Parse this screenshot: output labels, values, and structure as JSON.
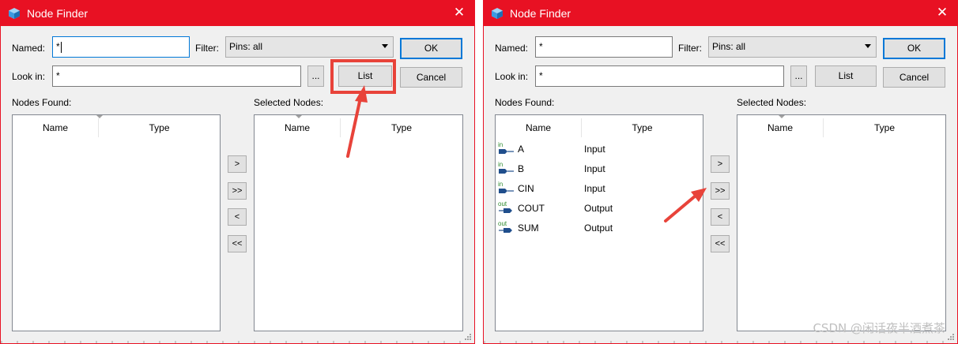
{
  "dialogs": [
    {
      "title": "Node Finder",
      "close_glyph": "✕",
      "named_label": "Named:",
      "named_value": "*",
      "filter_label": "Filter:",
      "filter_value": "Pins: all",
      "ok_label": "OK",
      "lookin_label": "Look in:",
      "lookin_value": "*",
      "browse_label": "...",
      "list_label": "List",
      "cancel_label": "Cancel",
      "nodes_found_label": "Nodes Found:",
      "selected_nodes_label": "Selected Nodes:",
      "col_name": "Name",
      "col_type": "Type",
      "move_one_label": ">",
      "move_all_label": ">>",
      "remove_one_label": "<",
      "remove_all_label": "<<",
      "nodes_found": []
    },
    {
      "title": "Node Finder",
      "close_glyph": "✕",
      "named_label": "Named:",
      "named_value": "*",
      "filter_label": "Filter:",
      "filter_value": "Pins: all",
      "ok_label": "OK",
      "lookin_label": "Look in:",
      "lookin_value": "*",
      "browse_label": "...",
      "list_label": "List",
      "cancel_label": "Cancel",
      "nodes_found_label": "Nodes Found:",
      "selected_nodes_label": "Selected Nodes:",
      "col_name": "Name",
      "col_type": "Type",
      "move_one_label": ">",
      "move_all_label": ">>",
      "remove_one_label": "<",
      "remove_all_label": "<<",
      "nodes_found": [
        {
          "name": "A",
          "type": "Input",
          "pin_icon": "input-pin-icon",
          "pin_tag": "in"
        },
        {
          "name": "B",
          "type": "Input",
          "pin_icon": "input-pin-icon",
          "pin_tag": "in"
        },
        {
          "name": "CIN",
          "type": "Input",
          "pin_icon": "input-pin-icon",
          "pin_tag": "in"
        },
        {
          "name": "COUT",
          "type": "Output",
          "pin_icon": "output-pin-icon",
          "pin_tag": "out"
        },
        {
          "name": "SUM",
          "type": "Output",
          "pin_icon": "output-pin-icon",
          "pin_tag": "out"
        }
      ]
    }
  ],
  "colors": {
    "titlebar": "#e81123",
    "annotation": "#e8433a",
    "pin_green": "#2e8b2e",
    "pin_blue": "#1f4e8c"
  },
  "watermark": "CSDN @闲话夜半酒煮茶"
}
